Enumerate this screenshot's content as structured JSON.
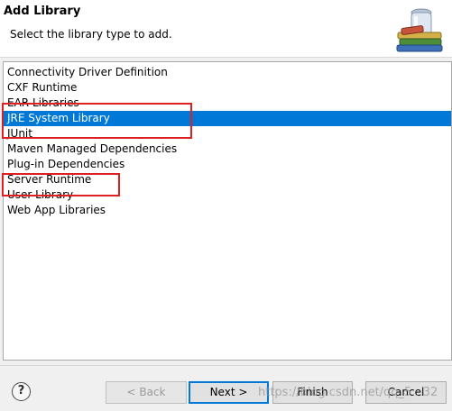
{
  "dialog": {
    "title": "Add Library",
    "subtitle": "Select the library type to add."
  },
  "list": {
    "items": [
      {
        "label": "Connectivity Driver Definition",
        "selected": false
      },
      {
        "label": "CXF Runtime",
        "selected": false
      },
      {
        "label": "EAR Libraries",
        "selected": false
      },
      {
        "label": "JRE System Library",
        "selected": true
      },
      {
        "label": "JUnit",
        "selected": false
      },
      {
        "label": "Maven Managed Dependencies",
        "selected": false
      },
      {
        "label": "Plug-in Dependencies",
        "selected": false
      },
      {
        "label": "Server Runtime",
        "selected": false
      },
      {
        "label": "User Library",
        "selected": false
      },
      {
        "label": "Web App Libraries",
        "selected": false
      }
    ]
  },
  "buttons": {
    "help": "?",
    "back": "< Back",
    "next": "Next >",
    "finish": "Finish",
    "cancel": "Cancel"
  },
  "watermark": "https://blog.csdn.net/qq_5...32",
  "colors": {
    "selection": "#0078d7",
    "annotation": "#e02020"
  },
  "icons": {
    "wizard": "library-books-jar-icon",
    "help": "help-icon"
  }
}
